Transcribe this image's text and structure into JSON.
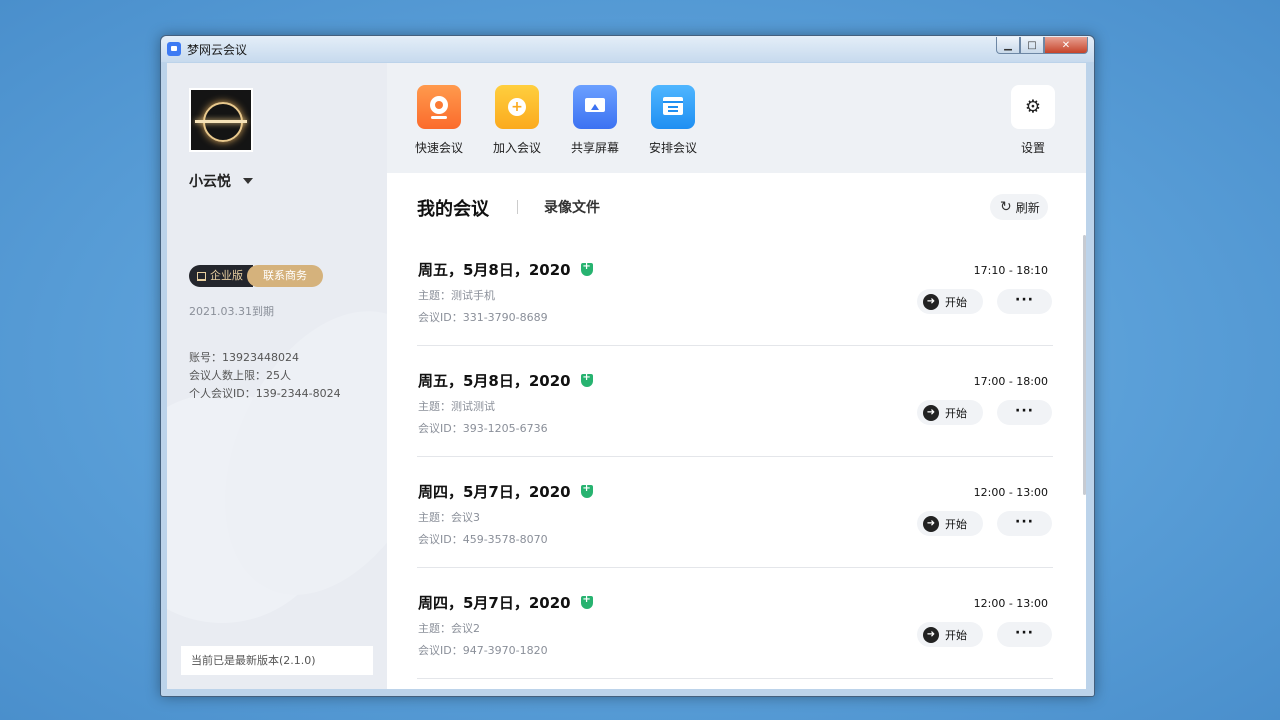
{
  "window": {
    "title": "梦网云会议",
    "controls": {
      "minimize": "▁",
      "maximize": "□",
      "close": "✕"
    }
  },
  "sidebar": {
    "username": "小云悦",
    "edition_badge": "企业版",
    "contact_badge": "联系商务",
    "expiry": "2021.03.31到期",
    "account": "账号：13923448024",
    "member_limit": "会议人数上限：25人",
    "personal_meeting_id": "个人会议ID：139-2344-8024",
    "version_status": "当前已是最新版本(2.1.0)"
  },
  "toolbar": {
    "actions": [
      {
        "label": "快速会议",
        "icon": "camera-icon",
        "color": "#fb6b2c"
      },
      {
        "label": "加入会议",
        "icon": "plus-circle-icon",
        "color": "#fbaa1e"
      },
      {
        "label": "共享屏幕",
        "icon": "share-screen-icon",
        "color": "#3c72f2"
      },
      {
        "label": "安排会议",
        "icon": "calendar-icon",
        "color": "#1f8ff2"
      }
    ],
    "settings_label": "设置"
  },
  "main": {
    "tabs": {
      "mine": "我的会议",
      "recordings": "录像文件"
    },
    "refresh_label": "刷新",
    "start_label": "开始",
    "more_label": "···",
    "meetings": [
      {
        "date": "周五，5月8日，2020",
        "topic": "主题：测试手机",
        "meeting_id": "会议ID：331-3790-8689",
        "time": "17:10 - 18:10"
      },
      {
        "date": "周五，5月8日，2020",
        "topic": "主题：测试测试",
        "meeting_id": "会议ID：393-1205-6736",
        "time": "17:00 - 18:00"
      },
      {
        "date": "周四，5月7日，2020",
        "topic": "主题：会议3",
        "meeting_id": "会议ID：459-3578-8070",
        "time": "12:00 - 13:00"
      },
      {
        "date": "周四，5月7日，2020",
        "topic": "主题：会议2",
        "meeting_id": "会议ID：947-3970-1820",
        "time": "12:00 - 13:00"
      }
    ]
  }
}
